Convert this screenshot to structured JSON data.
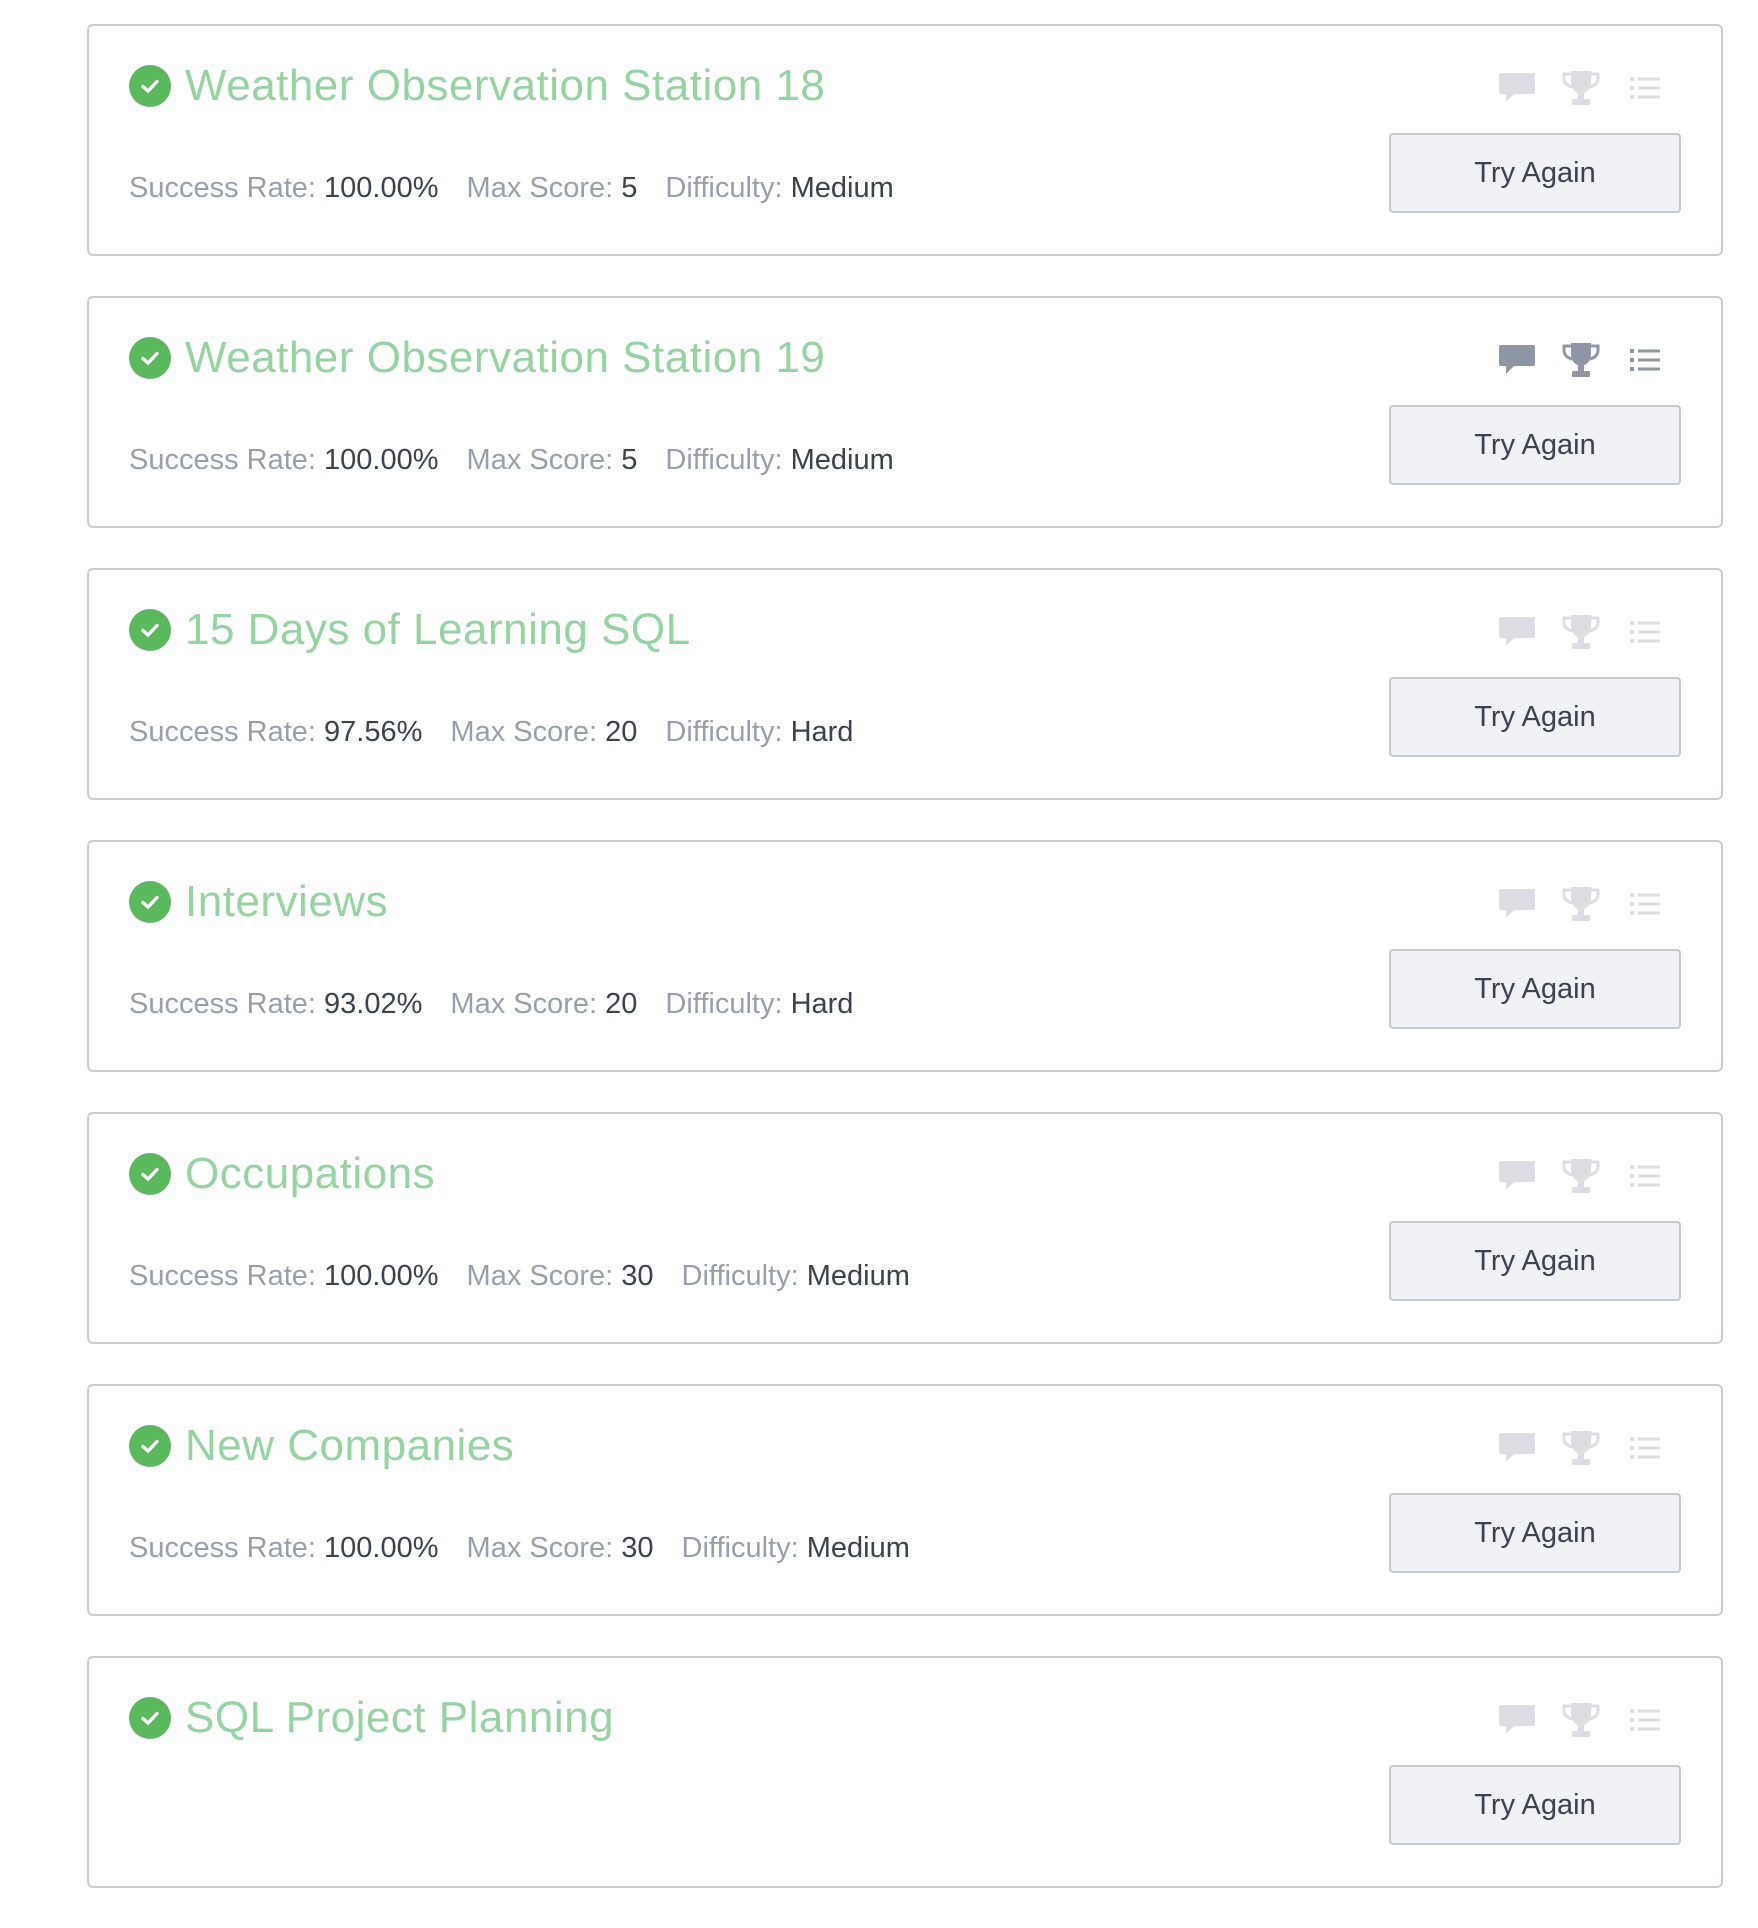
{
  "labels": {
    "success_rate": "Success Rate:",
    "max_score": "Max Score:",
    "difficulty": "Difficulty:",
    "try_again": "Try Again"
  },
  "colors": {
    "title_green": "#95d3a0",
    "check_green": "#5cb85c",
    "icon_light": "#dbdde3",
    "icon_dark": "#8e96a5",
    "label_gray": "#979faf",
    "value_dark": "#39424e"
  },
  "icon_names": [
    "discussion-icon",
    "leaderboard-trophy-icon",
    "editorial-list-icon"
  ],
  "challenges": [
    {
      "title": "Weather Observation Station 18",
      "success_rate": "100.00%",
      "max_score": "5",
      "difficulty": "Medium",
      "status": "solved",
      "icons_state": "light"
    },
    {
      "title": "Weather Observation Station 19",
      "success_rate": "100.00%",
      "max_score": "5",
      "difficulty": "Medium",
      "status": "solved",
      "icons_state": "dark"
    },
    {
      "title": "15 Days of Learning SQL",
      "success_rate": "97.56%",
      "max_score": "20",
      "difficulty": "Hard",
      "status": "solved",
      "icons_state": "light"
    },
    {
      "title": "Interviews",
      "success_rate": "93.02%",
      "max_score": "20",
      "difficulty": "Hard",
      "status": "solved",
      "icons_state": "light"
    },
    {
      "title": "Occupations",
      "success_rate": "100.00%",
      "max_score": "30",
      "difficulty": "Medium",
      "status": "solved",
      "icons_state": "light"
    },
    {
      "title": "New Companies",
      "success_rate": "100.00%",
      "max_score": "30",
      "difficulty": "Medium",
      "status": "solved",
      "icons_state": "light"
    },
    {
      "title": "SQL Project Planning",
      "success_rate": "",
      "max_score": "",
      "difficulty": "",
      "status": "solved",
      "icons_state": "light"
    }
  ]
}
